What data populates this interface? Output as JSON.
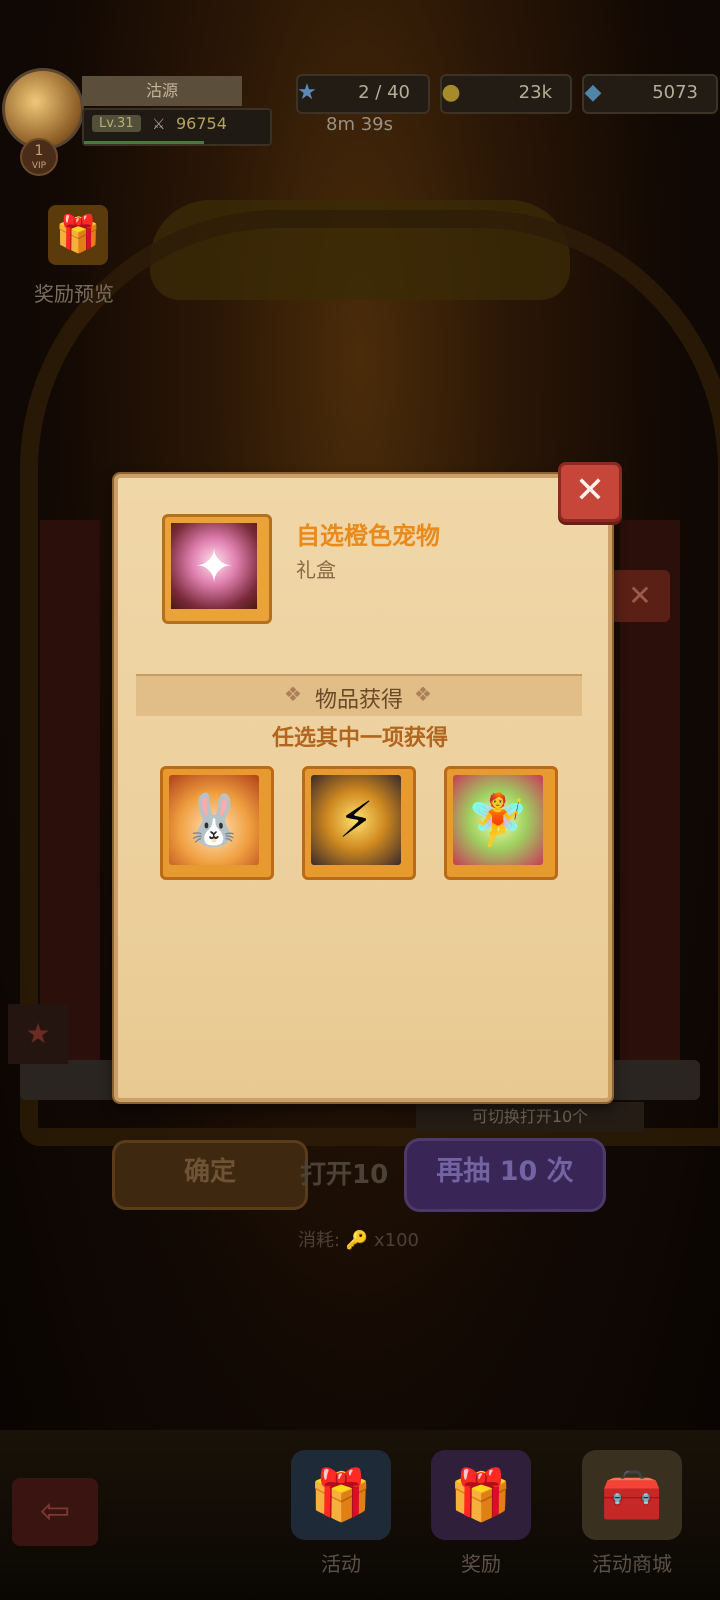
{
  "player": {
    "name": "沽源",
    "level": "Lv.31",
    "power": "96754",
    "vip_level": "1",
    "vip_label": "VIP"
  },
  "resources": [
    {
      "icon": "star-icon",
      "value": "2 / 40"
    },
    {
      "icon": "gold-coin-icon",
      "value": "23k"
    },
    {
      "icon": "diamond-icon",
      "value": "5073"
    }
  ],
  "timer": "8m 39s",
  "reward_preview": {
    "label": "奖励预览"
  },
  "modal": {
    "close_glyph": "✕",
    "item_title": "自选橙色宠物",
    "item_subtitle": "礼盒",
    "section_title": "物品获得",
    "choose_hint": "任选其中一项获得",
    "pets": [
      {
        "icon": "fire-bunny-pet-icon",
        "glyph": "🐰"
      },
      {
        "icon": "thunder-beast-pet-icon",
        "glyph": "⚡"
      },
      {
        "icon": "plant-fairy-pet-icon",
        "glyph": "🧚"
      }
    ]
  },
  "background": {
    "toggle_hint": "可切换打开10个",
    "confirm_label": "确定",
    "open10_label": "打开10",
    "redraw_label": "再抽 10 次",
    "cost_label": "消耗:",
    "cost_amount": "x100",
    "close_glyph": "✕"
  },
  "nav": {
    "back_glyph": "⇦",
    "items": [
      {
        "label": "活动",
        "icon": "gift-box-icon"
      },
      {
        "label": "奖励",
        "icon": "reward-box-icon"
      },
      {
        "label": "活动商城",
        "icon": "shop-chest-icon"
      }
    ]
  },
  "colors": {
    "title_orange": "#e88a1c",
    "close_red": "#c7463a",
    "parchment": "#f0d7a8"
  }
}
